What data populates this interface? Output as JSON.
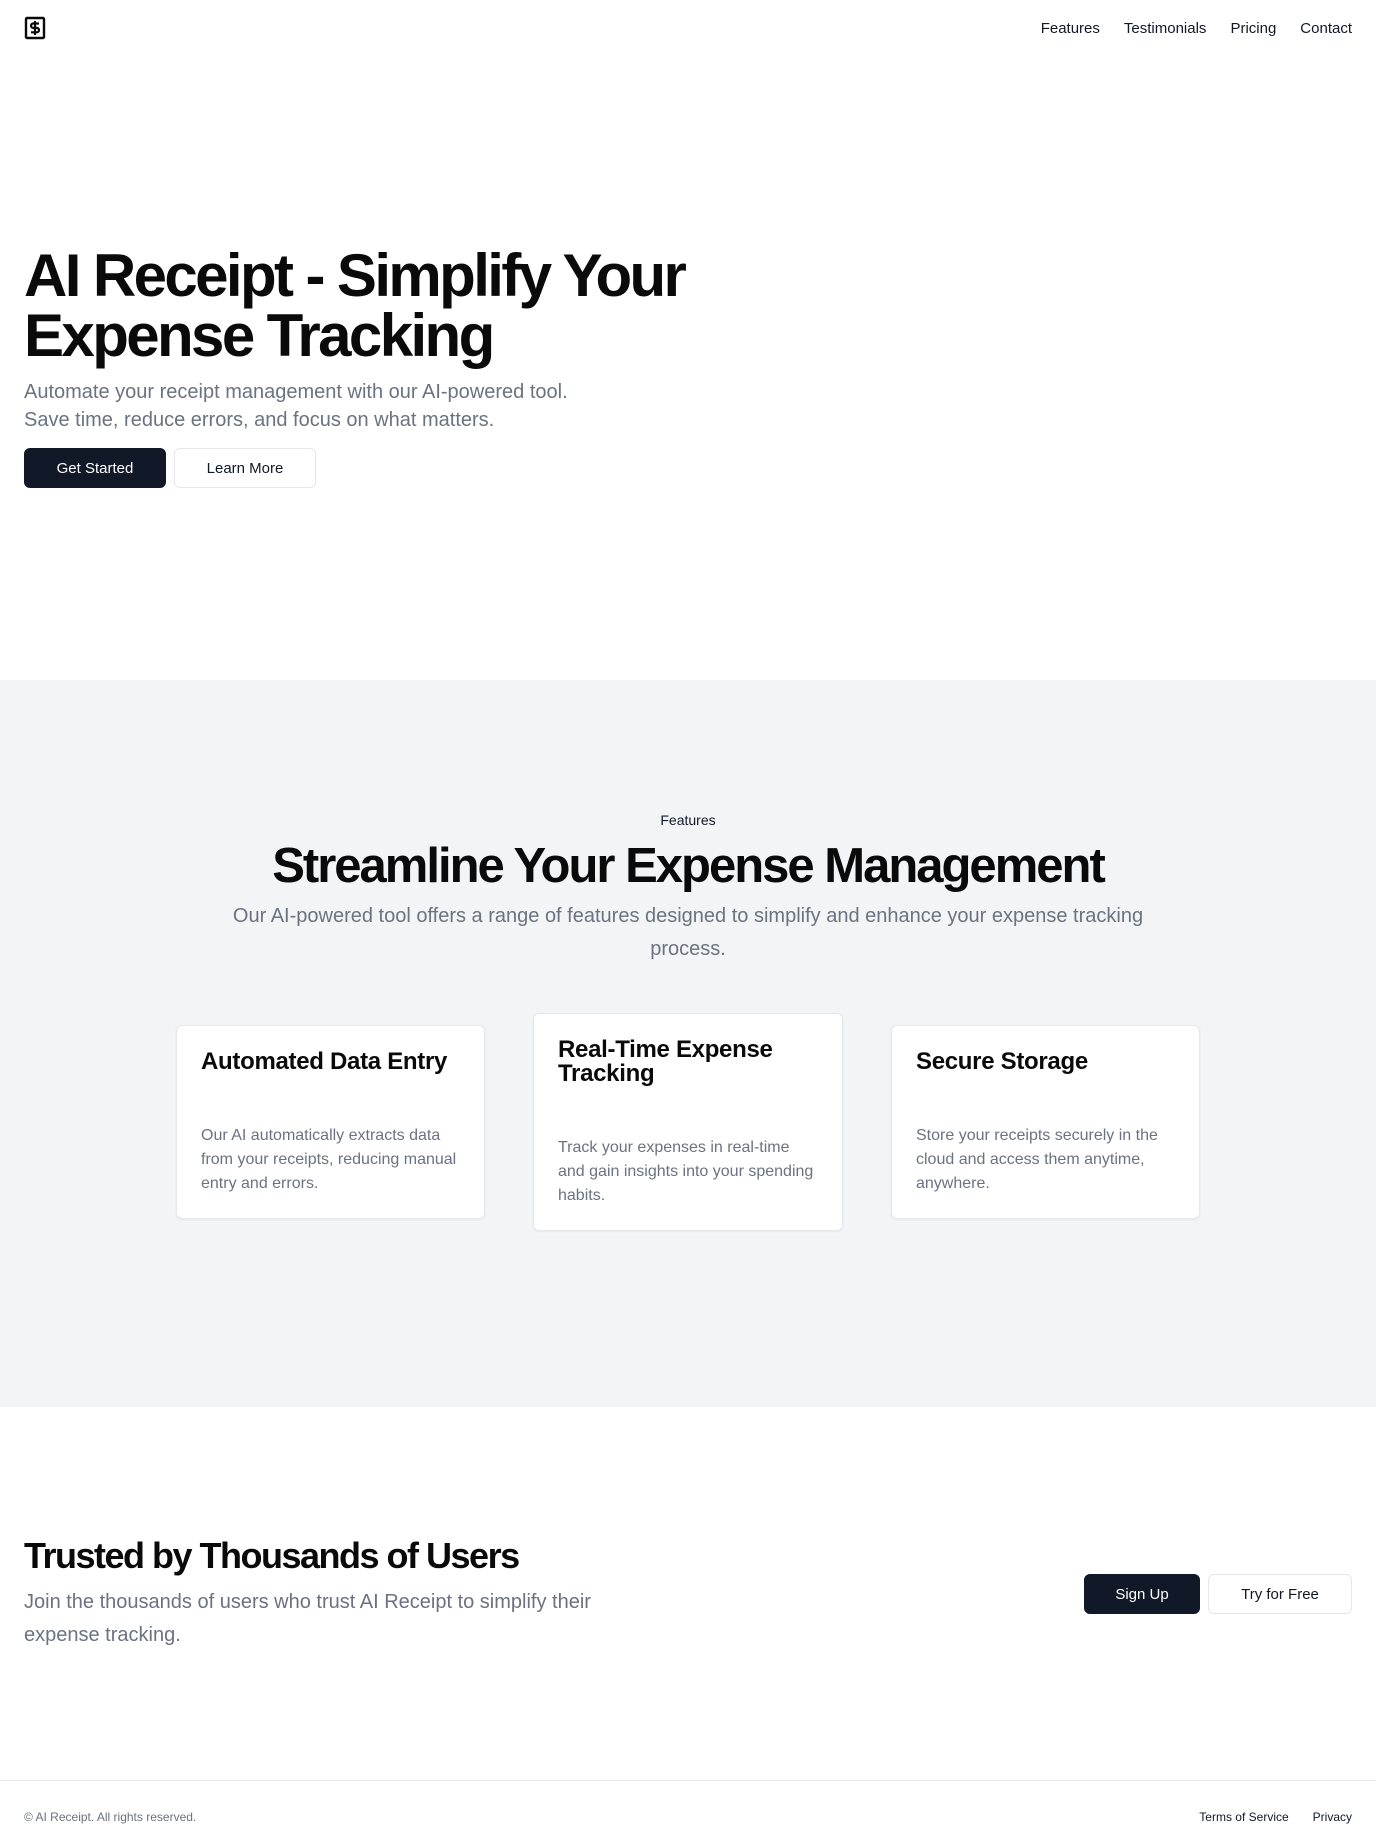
{
  "header": {
    "logo_icon": "receipt-dollar-icon",
    "nav": [
      "Features",
      "Testimonials",
      "Pricing",
      "Contact"
    ]
  },
  "hero": {
    "title_line1": "AI Receipt - Simplify Your",
    "title_line2": "Expense Tracking",
    "subtitle_line1": "Automate your receipt management with our AI-powered tool.",
    "subtitle_line2": "Save time, reduce errors, and focus on what matters.",
    "primary_button": "Get Started",
    "secondary_button": "Learn More"
  },
  "features": {
    "eyebrow": "Features",
    "title": "Streamline Your Expense Management",
    "subtitle": "Our AI-powered tool offers a range of features designed to simplify and enhance your expense tracking process.",
    "cards": [
      {
        "title": "Automated Data Entry",
        "description": "Our AI automatically extracts data from your receipts, reducing manual entry and errors."
      },
      {
        "title": "Real-Time Expense Tracking",
        "description": "Track your expenses in real-time and gain insights into your spending habits."
      },
      {
        "title": "Secure Storage",
        "description": "Store your receipts securely in the cloud and access them anytime, anywhere."
      }
    ]
  },
  "trusted": {
    "title": "Trusted by Thousands of Users",
    "subtitle": "Join the thousands of users who trust AI Receipt to simplify their expense tracking.",
    "primary_button": "Sign Up",
    "secondary_button": "Try for Free"
  },
  "footer": {
    "copyright": "© AI Receipt. All rights reserved.",
    "links": [
      "Terms of Service",
      "Privacy"
    ]
  },
  "colors": {
    "primary": "#111827",
    "muted_text": "#6b7280",
    "section_bg": "#f3f4f6",
    "border": "#e5e7eb"
  }
}
